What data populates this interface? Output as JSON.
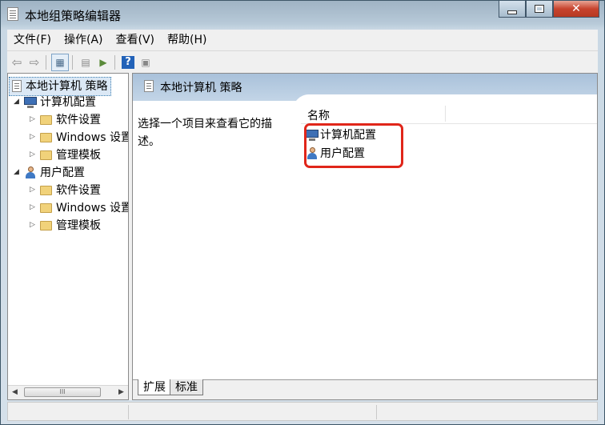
{
  "window": {
    "title": "本地组策略编辑器",
    "min_glyph": "",
    "max_glyph": "",
    "close_glyph": "✕"
  },
  "menu": [
    "文件(F)",
    "操作(A)",
    "查看(V)",
    "帮助(H)"
  ],
  "tree": {
    "root": "本地计算机 策略",
    "computer_config": "计算机配置",
    "computer_children": [
      "软件设置",
      "Windows 设置",
      "管理模板"
    ],
    "user_config": "用户配置",
    "user_children": [
      "软件设置",
      "Windows 设置",
      "管理模板"
    ]
  },
  "scroll_thumb_label": "III",
  "right": {
    "header_title": "本地计算机 策略",
    "description": "选择一个项目来查看它的描述。",
    "column_name": "名称",
    "items": [
      "计算机配置",
      "用户配置"
    ]
  },
  "tabs": [
    "扩展",
    "标准"
  ],
  "colors": {
    "highlight": "#e0261a",
    "header_band": "#b6cbe0"
  }
}
